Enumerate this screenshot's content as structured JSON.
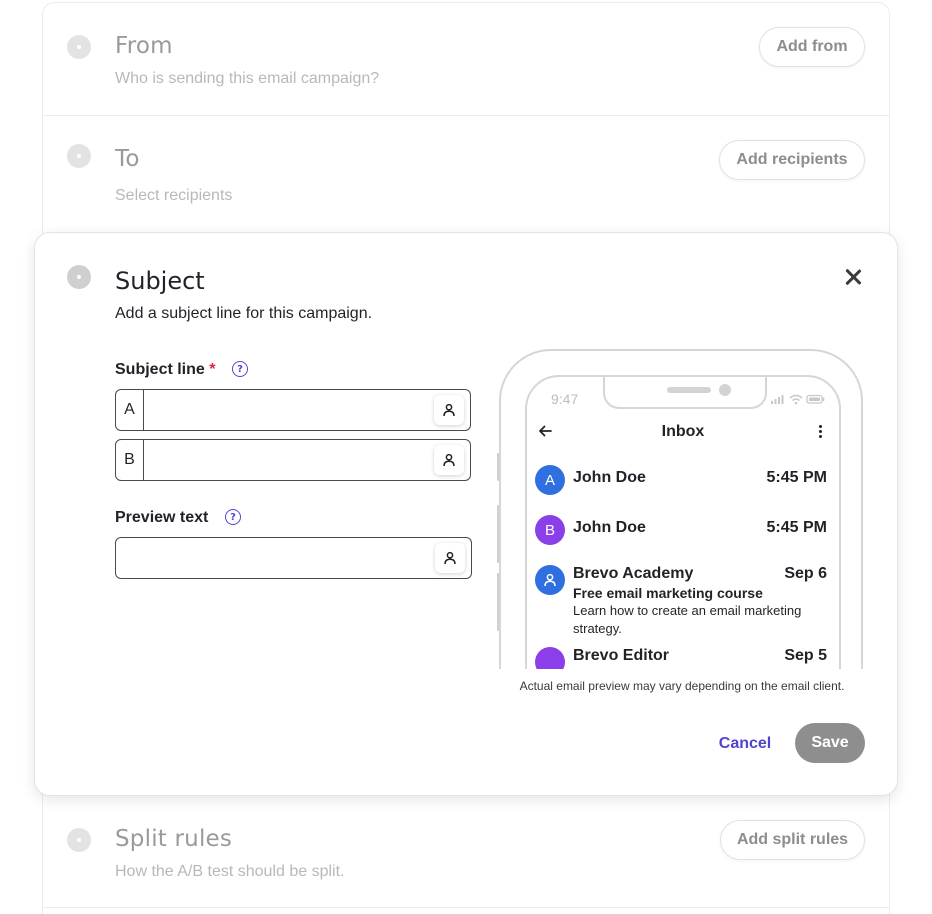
{
  "sections": {
    "from": {
      "title": "From",
      "subtitle": "Who is sending this email campaign?",
      "button": "Add from"
    },
    "to": {
      "title": "To",
      "subtitle": "Select recipients",
      "button": "Add recipients"
    },
    "subject": {
      "title": "Subject",
      "subtitle": "Add a subject line for this campaign.",
      "subject_line_label": "Subject line",
      "required_mark": "*",
      "variant_a": "A",
      "variant_b": "B",
      "variant_a_value": "",
      "variant_b_value": "",
      "preview_text_label": "Preview text",
      "preview_text_value": "",
      "help_glyph": "?",
      "preview_note": "Actual email preview may vary depending on the email client.",
      "cancel_label": "Cancel",
      "save_label": "Save"
    },
    "split_rules": {
      "title": "Split rules",
      "subtitle": "How the A/B test should be split.",
      "button": "Add split rules"
    }
  },
  "phone": {
    "time": "9:47",
    "inbox_title": "Inbox",
    "emails": [
      {
        "avatar": "A",
        "avatar_color": "#2f6fe0",
        "sender": "John Doe",
        "time": "5:45 PM",
        "subject": "",
        "body": ""
      },
      {
        "avatar": "B",
        "avatar_color": "#8b3fe8",
        "sender": "John Doe",
        "time": "5:45 PM",
        "subject": "",
        "body": ""
      },
      {
        "avatar": "person-icon",
        "avatar_color": "#2f6fe0",
        "sender": "Brevo Academy",
        "time": "Sep 6",
        "subject": "Free email marketing course",
        "body": "Learn how to create an email marketing strategy."
      },
      {
        "avatar": "",
        "avatar_color": "#8b3fe8",
        "sender": "Brevo Editor",
        "time": "Sep 5",
        "subject": "",
        "body": ""
      }
    ]
  },
  "colors": {
    "accent": "#4f44cf",
    "help_icon": "#5146d8",
    "required": "#e0244a",
    "save_disabled": "#8e8e8e"
  }
}
